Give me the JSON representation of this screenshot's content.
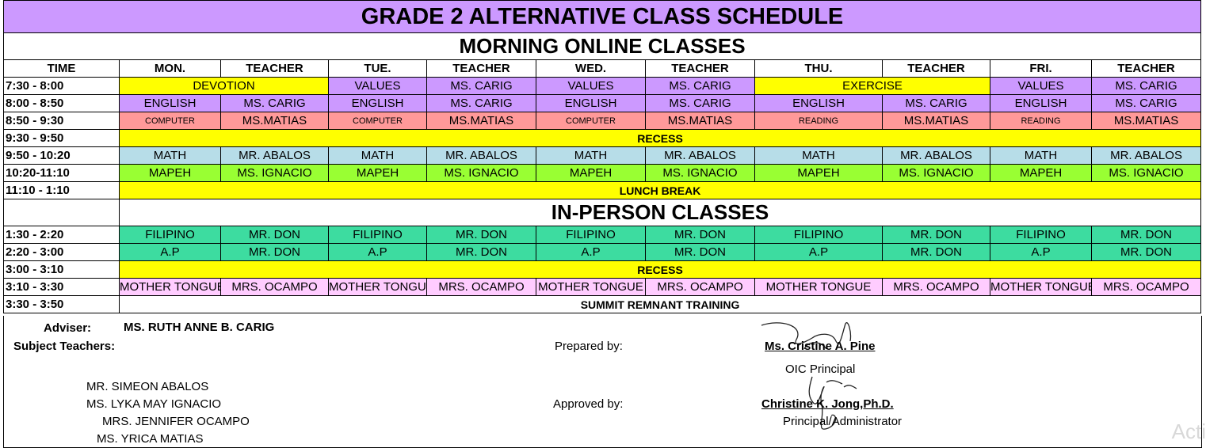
{
  "title": "GRADE 2 ALTERNATIVE CLASS SCHEDULE",
  "section_morning": "MORNING ONLINE CLASSES",
  "section_inperson": "IN-PERSON CLASSES",
  "headers": [
    "TIME",
    "MON.",
    "TEACHER",
    "TUE.",
    "TEACHER",
    "WED.",
    "TEACHER",
    "THU.",
    "TEACHER",
    "FRI.",
    "TEACHER"
  ],
  "rows": {
    "r1": {
      "time": "7:30 - 8:00",
      "mon": "DEVOTION",
      "tue": "VALUES",
      "tue_t": "MS. CARIG",
      "wed": "VALUES",
      "wed_t": "MS. CARIG",
      "thu": "EXERCISE",
      "fri": "VALUES",
      "fri_t": "MS. CARIG"
    },
    "r2": {
      "time": "8:00 - 8:50",
      "subject": "ENGLISH",
      "teacher": "MS. CARIG"
    },
    "r3": {
      "time": "8:50 - 9:30",
      "subject": "COMPUTER",
      "subject_alt": "READING",
      "teacher": "MS.MATIAS"
    },
    "r4": {
      "time": "9:30 - 9:50",
      "label": "RECESS"
    },
    "r5": {
      "time": "9:50 - 10:20",
      "subject": "MATH",
      "teacher": "MR. ABALOS"
    },
    "r6": {
      "time": "10:20-11:10",
      "subject": "MAPEH",
      "teacher": "MS. IGNACIO"
    },
    "r7": {
      "time": "11:10 - 1:10",
      "label": "LUNCH BREAK"
    },
    "r8": {
      "time": "1:30 - 2:20",
      "subject": "FILIPINO",
      "teacher": "MR. DON"
    },
    "r9": {
      "time": "2:20 - 3:00",
      "subject": "A.P",
      "teacher": "MR. DON"
    },
    "r10": {
      "time": "3:00 - 3:10",
      "label": "RECESS"
    },
    "r11": {
      "time": "3:10 - 3:30",
      "subject": "MOTHER TONGUE",
      "teacher": "MRS. OCAMPO"
    },
    "r12": {
      "time": "3:30 - 3:50",
      "label": "SUMMIT REMNANT TRAINING"
    }
  },
  "footer": {
    "adviser_label": "Adviser:",
    "adviser_name": "MS. RUTH ANNE B. CARIG",
    "subject_teachers_label": "Subject Teachers:",
    "teachers": [
      "MR. SIMEON ABALOS",
      "MS. LYKA MAY IGNACIO",
      "MRS. JENNIFER OCAMPO",
      "MS. YRICA MATIAS"
    ],
    "prepared_label": "Prepared by:",
    "prepared_name": "Ms. Cristine A. Pine",
    "prepared_title": "OIC Principal",
    "approved_label": "Approved by:",
    "approved_name": "Christine K. Jong,Ph.D.",
    "approved_title": "Principal/Administrator"
  },
  "watermark": "Acti",
  "colors": {
    "title_bg": "#cc99ff",
    "yellow": "#ffff00",
    "purple": "#cc99ff",
    "salmon": "#ff9999",
    "light_blue": "#b7dde8",
    "green": "#99ff33",
    "teal": "#3ddca0",
    "pink": "#ffccff"
  }
}
